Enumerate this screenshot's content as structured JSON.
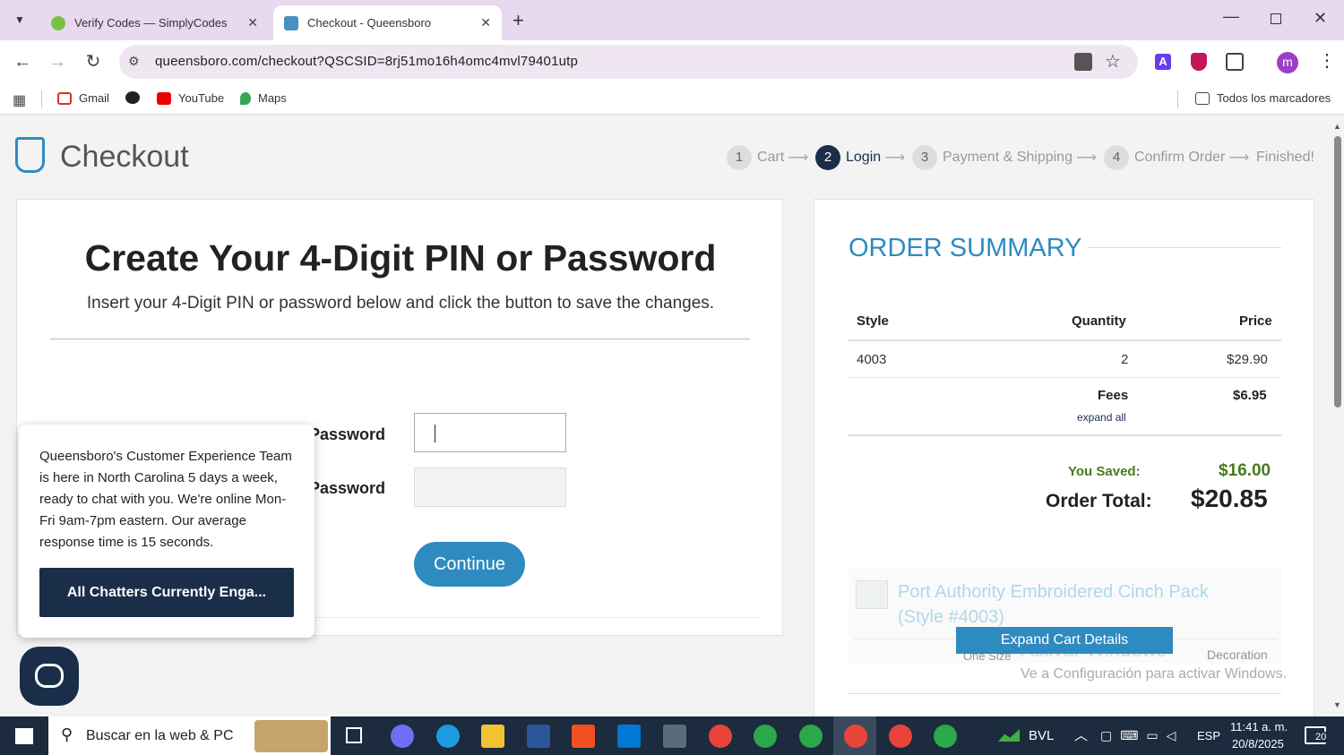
{
  "browser": {
    "tabs": [
      {
        "title": "Verify Codes — SimplyCodes"
      },
      {
        "title": "Checkout - Queensboro"
      }
    ],
    "url": "queensboro.com/checkout?QSCSID=8rj51mo16h4omc4mvl79401utp",
    "avatar_letter": "m",
    "bookmarks": [
      "Gmail",
      "YouTube",
      "Maps"
    ],
    "all_bookmarks": "Todos los marcadores"
  },
  "header": {
    "title": "Checkout",
    "steps": [
      {
        "num": "1",
        "label": "Cart"
      },
      {
        "num": "2",
        "label": "Login"
      },
      {
        "num": "3",
        "label": "Payment & Shipping"
      },
      {
        "num": "4",
        "label": "Confirm Order"
      },
      {
        "num": "",
        "label": "Finished!"
      }
    ]
  },
  "form": {
    "heading": "Create Your 4-Digit PIN or Password",
    "subheading": "Insert your 4-Digit PIN or password below and click the button to save the changes.",
    "password_label": "Password",
    "confirm_label": "Password",
    "continue_label": "Continue"
  },
  "chat": {
    "message": "Queensboro's Customer Experience Team is here in North Carolina 5 days a week, ready to chat with you. We're online Mon-Fri 9am-7pm eastern. Our average response time is 15 seconds.",
    "button": "All Chatters Currently Enga..."
  },
  "summary": {
    "title": "ORDER SUMMARY",
    "columns": [
      "Style",
      "Quantity",
      "Price"
    ],
    "rows": [
      {
        "style": "4003",
        "quantity": "2",
        "price": "$29.90"
      }
    ],
    "fees_label": "Fees",
    "fees_value": "$6.95",
    "expand_all": "expand all",
    "saved_label": "You Saved:",
    "saved_value": "$16.00",
    "total_label": "Order Total:",
    "total_value": "$20.85",
    "product_name": "Port Authority Embroidered Cinch Pack (Style #4003)",
    "expand_cart": "Expand Cart Details",
    "size_label": "One Size",
    "decoration_label": "Decoration",
    "watermark_1": "Activar Windows",
    "watermark_2": "Ve a Configuración para activar Windows."
  },
  "taskbar": {
    "search": "Buscar en la web & PC",
    "stock": "BVL",
    "lang": "ESP",
    "time": "11:41 a. m.",
    "date": "20/8/2025",
    "notif": "20"
  },
  "colors": {
    "navy": "#1a2e4a",
    "accent_blue": "#2e8bc0",
    "green": "#4a7a1e"
  }
}
